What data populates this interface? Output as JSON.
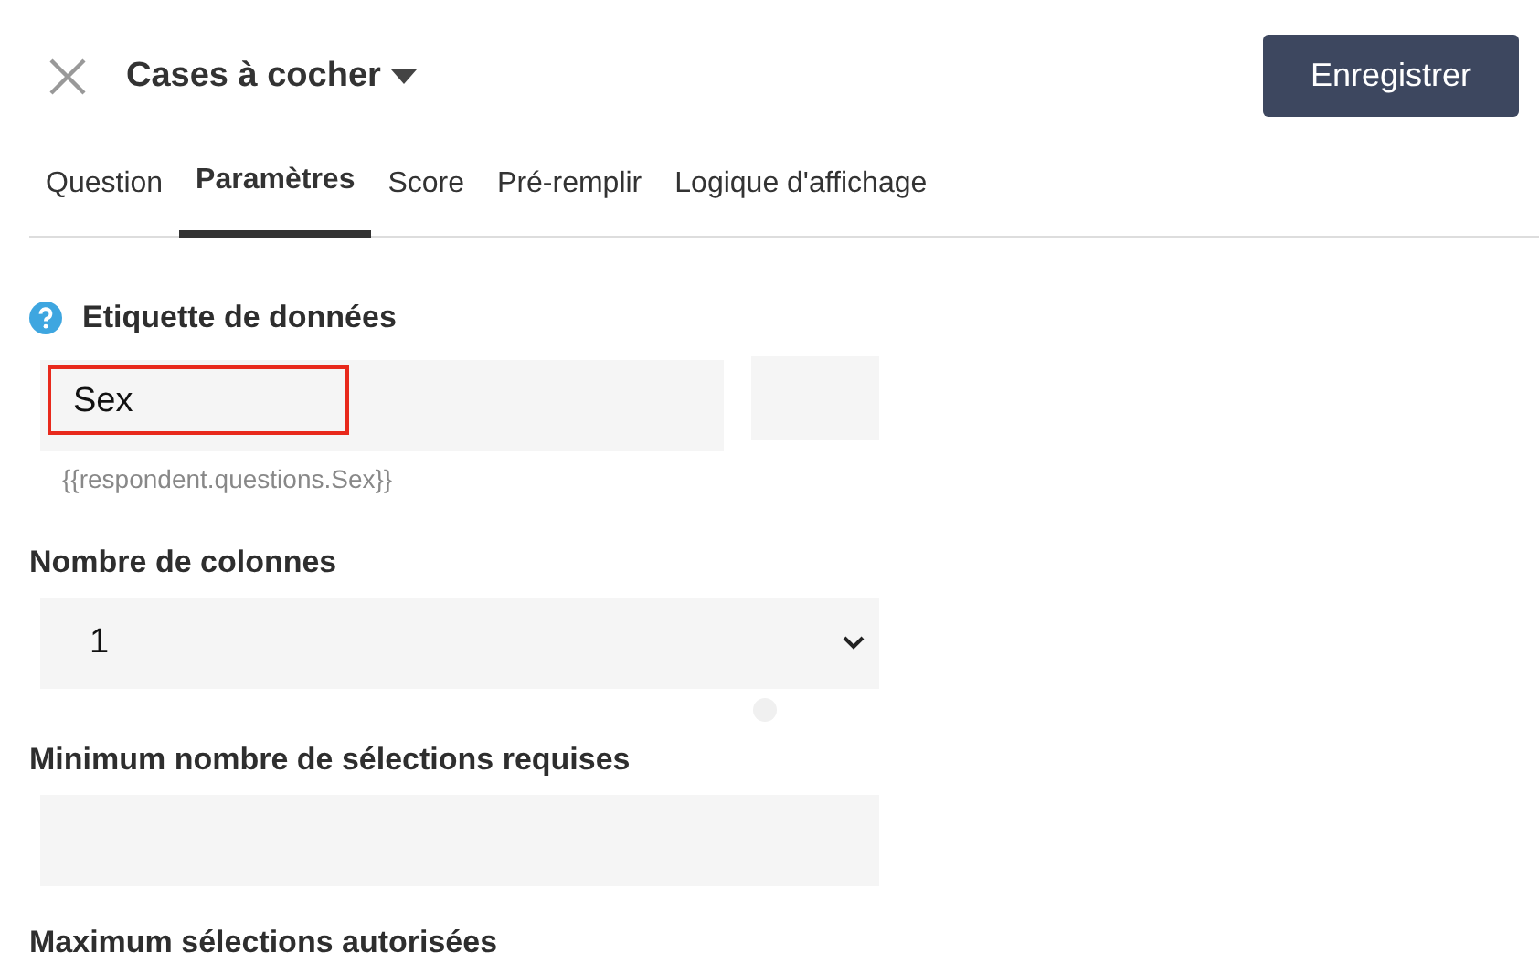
{
  "header": {
    "title": "Cases à cocher",
    "save_button": "Enregistrer"
  },
  "tabs": [
    {
      "label": "Question",
      "selected": false
    },
    {
      "label": "Paramètres",
      "selected": true
    },
    {
      "label": "Score",
      "selected": false
    },
    {
      "label": "Pré-remplir",
      "selected": false
    },
    {
      "label": "Logique d'affichage",
      "selected": false
    }
  ],
  "data_label": {
    "label": "Etiquette de données",
    "value": "Sex",
    "highlighted": true,
    "hint": "{{respondent.questions.Sex}}"
  },
  "columns": {
    "label": "Nombre de colonnes",
    "value": "1"
  },
  "min_selections": {
    "label": "Minimum nombre de sélections requises"
  },
  "max_selections": {
    "label": "Maximum sélections autorisées"
  }
}
